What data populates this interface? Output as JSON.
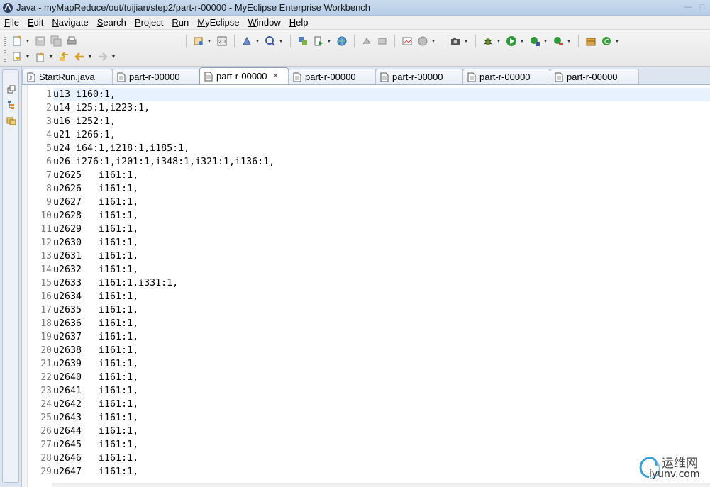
{
  "window": {
    "title": "Java - myMapReduce/out/tuijian/step2/part-r-00000 - MyEclipse Enterprise Workbench"
  },
  "menu": [
    {
      "mnemonic": "F",
      "rest": "ile"
    },
    {
      "mnemonic": "E",
      "rest": "dit"
    },
    {
      "mnemonic": "N",
      "rest": "avigate"
    },
    {
      "mnemonic": "S",
      "rest": "earch"
    },
    {
      "mnemonic": "P",
      "rest": "roject"
    },
    {
      "mnemonic": "R",
      "rest": "un"
    },
    {
      "mnemonic": "M",
      "rest": "yEclipse"
    },
    {
      "mnemonic": "W",
      "rest": "indow"
    },
    {
      "mnemonic": "H",
      "rest": "elp"
    }
  ],
  "tabs": [
    {
      "label": "StartRun.java",
      "icon": "java-file-icon",
      "active": false
    },
    {
      "label": "part-r-00000",
      "icon": "text-file-icon",
      "active": false
    },
    {
      "label": "part-r-00000",
      "icon": "text-file-icon",
      "active": true
    },
    {
      "label": "part-r-00000",
      "icon": "text-file-icon",
      "active": false
    },
    {
      "label": "part-r-00000",
      "icon": "text-file-icon",
      "active": false
    },
    {
      "label": "part-r-00000",
      "icon": "text-file-icon",
      "active": false
    },
    {
      "label": "part-r-00000",
      "icon": "text-file-icon",
      "active": false
    }
  ],
  "editor": {
    "current_line": 1,
    "lines": [
      {
        "n": "1",
        "text": "u13 i160:1,"
      },
      {
        "n": "2",
        "text": "u14 i25:1,i223:1,"
      },
      {
        "n": "3",
        "text": "u16 i252:1,"
      },
      {
        "n": "4",
        "text": "u21 i266:1,"
      },
      {
        "n": "5",
        "text": "u24 i64:1,i218:1,i185:1,"
      },
      {
        "n": "6",
        "text": "u26 i276:1,i201:1,i348:1,i321:1,i136:1,"
      },
      {
        "n": "7",
        "text": "u2625   i161:1,"
      },
      {
        "n": "8",
        "text": "u2626   i161:1,"
      },
      {
        "n": "9",
        "text": "u2627   i161:1,"
      },
      {
        "n": "10",
        "text": "u2628   i161:1,"
      },
      {
        "n": "11",
        "text": "u2629   i161:1,"
      },
      {
        "n": "12",
        "text": "u2630   i161:1,"
      },
      {
        "n": "13",
        "text": "u2631   i161:1,"
      },
      {
        "n": "14",
        "text": "u2632   i161:1,"
      },
      {
        "n": "15",
        "text": "u2633   i161:1,i331:1,"
      },
      {
        "n": "16",
        "text": "u2634   i161:1,"
      },
      {
        "n": "17",
        "text": "u2635   i161:1,"
      },
      {
        "n": "18",
        "text": "u2636   i161:1,"
      },
      {
        "n": "19",
        "text": "u2637   i161:1,"
      },
      {
        "n": "20",
        "text": "u2638   i161:1,"
      },
      {
        "n": "21",
        "text": "u2639   i161:1,"
      },
      {
        "n": "22",
        "text": "u2640   i161:1,"
      },
      {
        "n": "23",
        "text": "u2641   i161:1,"
      },
      {
        "n": "24",
        "text": "u2642   i161:1,"
      },
      {
        "n": "25",
        "text": "u2643   i161:1,"
      },
      {
        "n": "26",
        "text": "u2644   i161:1,"
      },
      {
        "n": "27",
        "text": "u2645   i161:1,"
      },
      {
        "n": "28",
        "text": "u2646   i161:1,"
      },
      {
        "n": "29",
        "text": "u2647   i161:1,"
      }
    ]
  },
  "watermark": {
    "cn": "运维网",
    "en": "iyunv.com"
  },
  "colors": {
    "current_line": "#e8f2fe",
    "line_number": "#787878",
    "title_bar": "#c9dbee",
    "tab_active_border": "#8aa1c1"
  }
}
